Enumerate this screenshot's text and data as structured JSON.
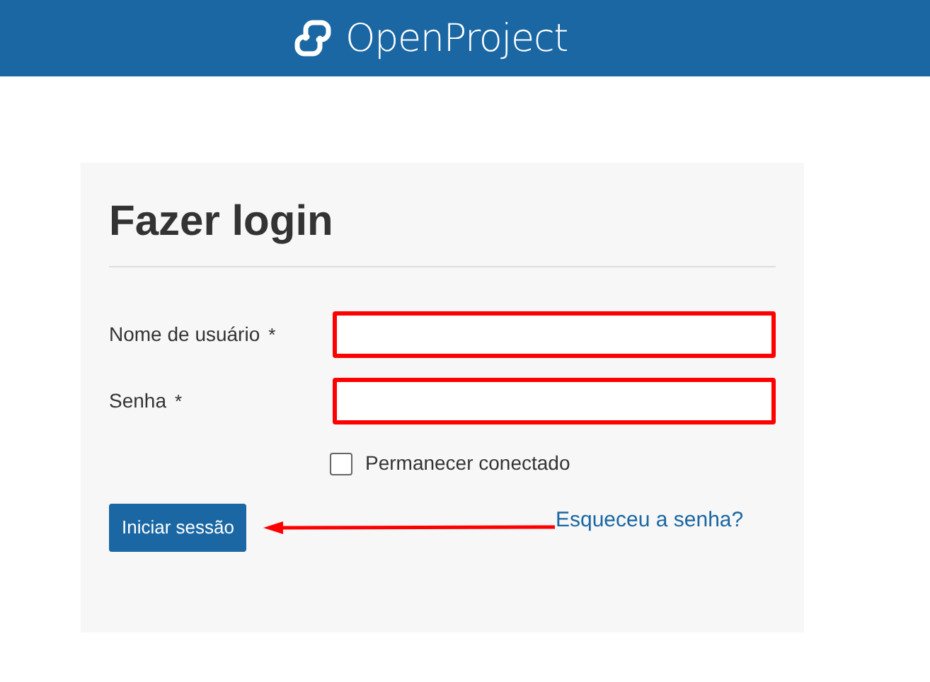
{
  "header": {
    "logo_text": "OpenProject"
  },
  "login": {
    "title": "Fazer login",
    "fields": [
      {
        "label": "Nome de usuário",
        "required_mark": "*",
        "highlighted": true
      },
      {
        "label": "Senha",
        "required_mark": "*",
        "highlighted": true
      }
    ],
    "remember": {
      "label": "Permanecer conectado",
      "checked": false
    },
    "submit": "Iniciar sessão",
    "forgot_link": "Esqueceu a senha?",
    "annotation_arrow": true
  }
}
